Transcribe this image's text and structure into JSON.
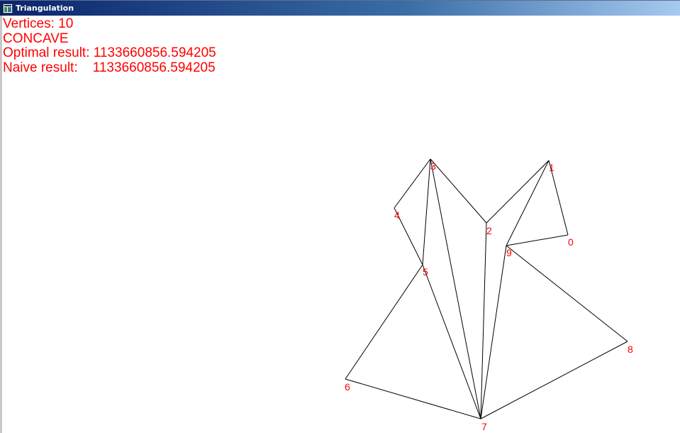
{
  "window": {
    "title": "Triangulation",
    "icon": "window-app-icon"
  },
  "info": {
    "color": "#ff0000",
    "lines": {
      "vertices": "Vertices: 10",
      "shape": "CONCAVE",
      "optimal": "Optimal result: 1133660856.594205",
      "naive": "Naive result:    1133660856.594205"
    }
  },
  "colors": {
    "edge": "#000000",
    "label": "#ff0000",
    "titlebar_start": "#0a246a",
    "titlebar_end": "#a6caf0"
  },
  "polygon": {
    "vertex_labels": [
      "0",
      "1",
      "2",
      "3",
      "4",
      "5",
      "6",
      "7",
      "8",
      "9"
    ]
  }
}
